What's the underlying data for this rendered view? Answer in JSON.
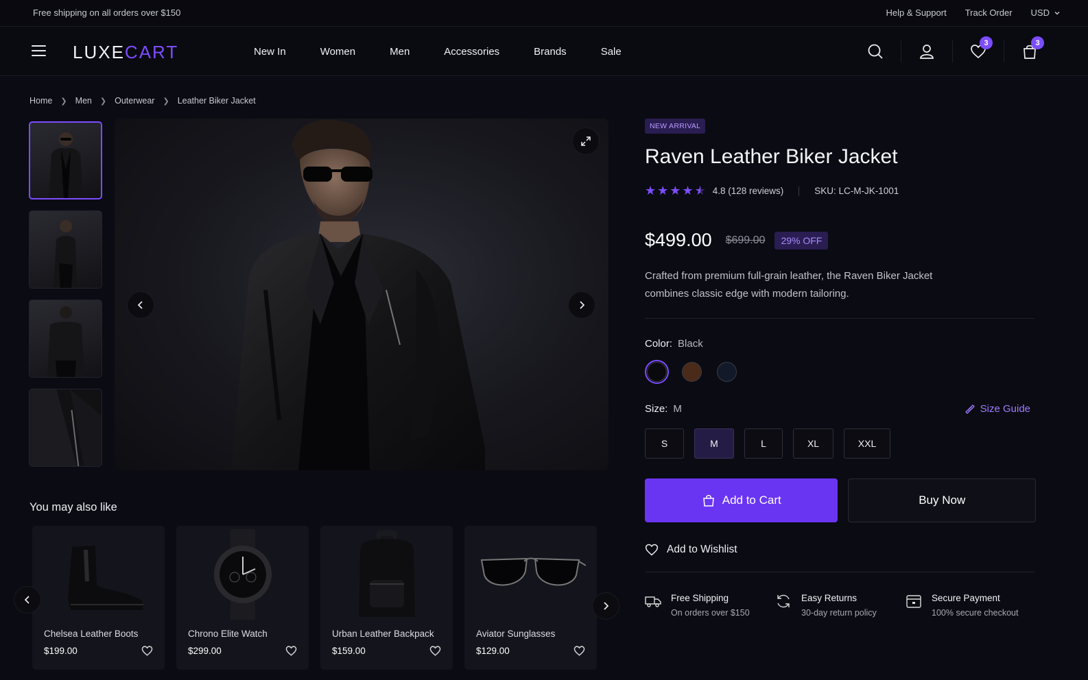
{
  "topbar": {
    "promo": "Free shipping on all orders over $150",
    "help": "Help & Support",
    "track": "Track Order",
    "currency": "USD"
  },
  "nav": {
    "logo_a": "LUXE",
    "logo_b": "CART",
    "items": [
      "New In",
      "Women",
      "Men",
      "Accessories",
      "Brands",
      "Sale"
    ],
    "wishlist_count": "3",
    "cart_count": "3"
  },
  "breadcrumb": [
    "Home",
    "Men",
    "Outerwear",
    "Leather Biker Jacket"
  ],
  "product": {
    "tag": "NEW ARRIVAL",
    "title": "Raven Leather Biker Jacket",
    "rating_value": "4.8",
    "reviews": "(128 reviews)",
    "rating_stars": 4.5,
    "sku": "SKU: LC-M-JK-1001",
    "price": "$499.00",
    "old_price": "$699.00",
    "discount": "29% OFF",
    "description": "Crafted from premium full-grain leather, the Raven Biker Jacket combines classic edge with modern tailoring.",
    "color_label": "Color:",
    "color_value": "Black",
    "colors": [
      "#0a0a0e",
      "#4a2a18",
      "#121a2a"
    ],
    "size_label": "Size:",
    "size_value": "M",
    "size_guide": "Size Guide",
    "sizes": [
      "S",
      "M",
      "L",
      "XL",
      "XXL"
    ],
    "add_to_cart": "Add to Cart",
    "buy_now": "Buy Now",
    "add_to_wishlist": "Add to Wishlist"
  },
  "features": [
    {
      "title": "Free Shipping",
      "sub": "On orders over $150",
      "icon": "truck-icon"
    },
    {
      "title": "Easy Returns",
      "sub": "30-day return policy",
      "icon": "refresh-icon"
    },
    {
      "title": "Secure Payment",
      "sub": "100% secure checkout",
      "icon": "card-icon"
    }
  ],
  "related": {
    "heading": "You may also like",
    "items": [
      {
        "name": "Chelsea Leather Boots",
        "price": "$199.00",
        "icon": "boot-icon"
      },
      {
        "name": "Chrono Elite Watch",
        "price": "$299.00",
        "icon": "watch-icon"
      },
      {
        "name": "Urban Leather Backpack",
        "price": "$159.00",
        "icon": "backpack-icon"
      },
      {
        "name": "Aviator Sunglasses",
        "price": "$129.00",
        "icon": "sunglasses-icon"
      }
    ]
  },
  "colors": {
    "accent": "#7c4dff",
    "background": "#0b0b13"
  }
}
